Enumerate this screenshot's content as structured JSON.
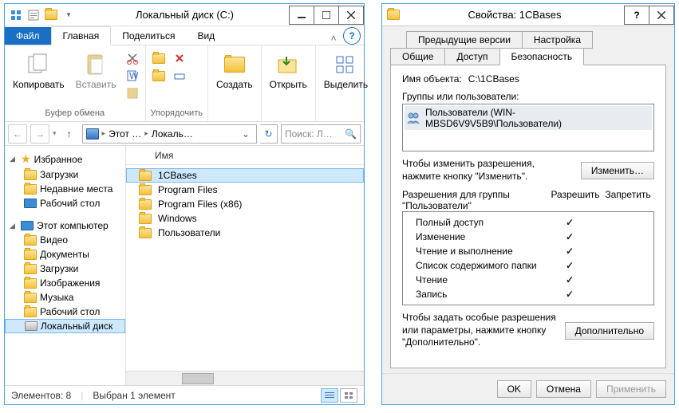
{
  "explorer": {
    "title": "Локальный диск (C:)",
    "tabs": {
      "file": "Файл",
      "home": "Главная",
      "share": "Поделиться",
      "view": "Вид"
    },
    "ribbon": {
      "clipboard": {
        "copy": "Копировать",
        "paste": "Вставить",
        "label": "Буфер обмена"
      },
      "organize": {
        "label": "Упорядочить"
      },
      "new": {
        "create": "Создать"
      },
      "open": {
        "open": "Открыть"
      },
      "select": {
        "select": "Выделить"
      }
    },
    "address": {
      "root": "Этот …",
      "current": "Локаль…",
      "search_placeholder": "Поиск: Л…"
    },
    "nav": {
      "favorites": "Избранное",
      "downloads": "Загрузки",
      "recent": "Недавние места",
      "desktop": "Рабочий стол",
      "thispc": "Этот компьютер",
      "videos": "Видео",
      "documents": "Документы",
      "downloads2": "Загрузки",
      "pictures": "Изображения",
      "music": "Музыка",
      "desktop2": "Рабочий стол",
      "localdisk": "Локальный диск"
    },
    "columns": {
      "name": "Имя"
    },
    "files": [
      {
        "name": "1CBases"
      },
      {
        "name": "Program Files"
      },
      {
        "name": "Program Files (x86)"
      },
      {
        "name": "Windows"
      },
      {
        "name": "Пользователи"
      }
    ],
    "status": {
      "count": "Элементов: 8",
      "selection": "Выбран 1 элемент"
    }
  },
  "props": {
    "title": "Свойства: 1CBases",
    "tabs": {
      "prev": "Предыдущие версии",
      "custom": "Настройка",
      "general": "Общие",
      "sharing": "Доступ",
      "security": "Безопасность"
    },
    "object_label": "Имя объекта:",
    "object_path": "C:\\1CBases",
    "groups_label": "Группы или пользователи:",
    "group_entry": "Пользователи (WIN-MBSD6V9V5B9\\Пользователи)",
    "edit_hint": "Чтобы изменить разрешения, нажмите кнопку \"Изменить\".",
    "btn_edit": "Изменить…",
    "perms_for": "Разрешения для группы \"Пользователи\"",
    "col_allow": "Разрешить",
    "col_deny": "Запретить",
    "perms": [
      {
        "label": "Полный доступ",
        "allow": true
      },
      {
        "label": "Изменение",
        "allow": true
      },
      {
        "label": "Чтение и выполнение",
        "allow": true
      },
      {
        "label": "Список содержимого папки",
        "allow": true
      },
      {
        "label": "Чтение",
        "allow": true
      },
      {
        "label": "Запись",
        "allow": true
      }
    ],
    "advanced_hint": "Чтобы задать особые разрешения или параметры, нажмите кнопку \"Дополнительно\".",
    "btn_advanced": "Дополнительно",
    "btn_ok": "OK",
    "btn_cancel": "Отмена",
    "btn_apply": "Применить"
  }
}
